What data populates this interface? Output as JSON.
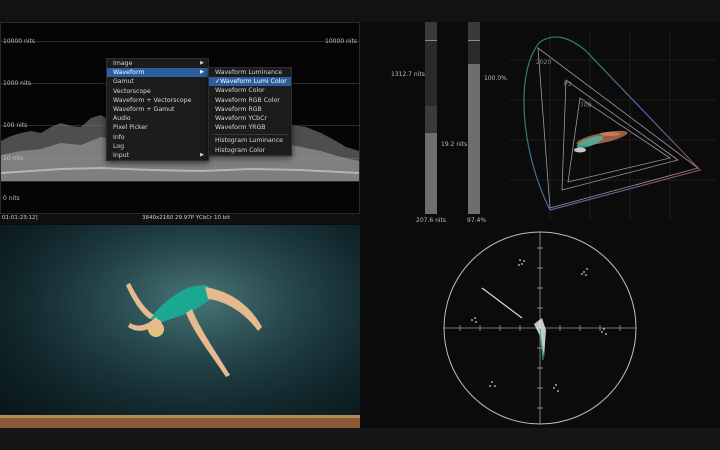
{
  "waveform": {
    "top_left": "10000 nits",
    "top_right": "10000 nits",
    "l1000": "1000 nits",
    "l100": "100 nits",
    "l10": "10 nits",
    "l0": "0 nits"
  },
  "status": {
    "timecode": "01:01:23:12]",
    "format": "3840x2160 29.97P YCbCr 10 bit"
  },
  "menu": {
    "items": [
      "Image",
      "Waveform",
      "Gamut",
      "Vectorscope",
      "Waveform + Vectorscope",
      "Waveform + Gamut",
      "Audio",
      "Pixel Picker",
      "Info",
      "Log",
      "Input"
    ],
    "selected_index": 1,
    "submenu": [
      "Waveform Luminance",
      "Waveform Lumi Color",
      "Waveform Color",
      "Waveform RGB Color",
      "Waveform RGB",
      "Waveform YCbCr",
      "Waveform YRGB",
      "Histogram Luminance",
      "Histogram Color"
    ],
    "submenu_selected": "✓Waveform Lumi Color"
  },
  "meters": {
    "nits_max": "1312.7 nits",
    "nits_avg": "19.2 nits",
    "nits_min": "207.6 nits",
    "pct_max": "100.0%",
    "pct_min": "97.4%",
    "nits_level": 0.42,
    "pct_level": 0.78
  },
  "gamut": {
    "labels": [
      "2020",
      "P3",
      "709"
    ]
  },
  "colors": {
    "menu_highlight": "#2d5fa0",
    "background": "#0b0b0b"
  }
}
